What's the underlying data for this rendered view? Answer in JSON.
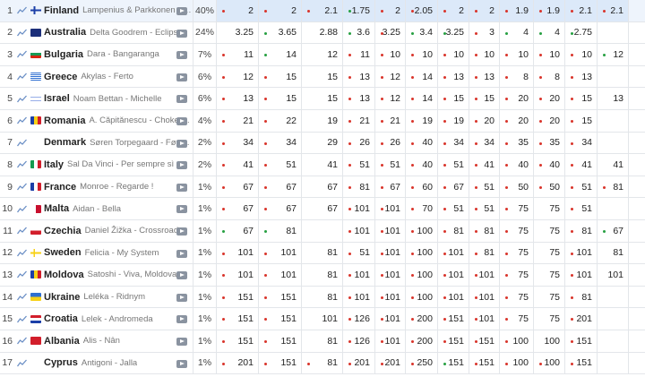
{
  "colors": {
    "red_dot": "#d9342b",
    "green_dot": "#26a041",
    "highlight": "#dce9f9",
    "trend_line": "#6b8fc5"
  },
  "icons": {
    "trend": "chart-line-icon",
    "video": "video-play-icon"
  },
  "rows": [
    {
      "rank": "1",
      "country": "Finland",
      "entry": "Lampenius & Parkkonen - Liekinheitin",
      "flag": "fi",
      "pct": "40%",
      "odds": [
        [
          "2",
          "r"
        ],
        [
          "2",
          "r"
        ],
        [
          "2.1",
          "r"
        ],
        [
          "1.75",
          "g"
        ],
        [
          "2",
          "r"
        ],
        [
          "2.05",
          "r"
        ],
        [
          "2",
          "r"
        ],
        [
          "2",
          "r"
        ],
        [
          "1.9",
          "r"
        ],
        [
          "1.9",
          "r"
        ],
        [
          "2.1",
          "r"
        ],
        [
          "2.1",
          "r"
        ]
      ]
    },
    {
      "rank": "2",
      "country": "Australia",
      "entry": "Delta Goodrem - Eclipse",
      "flag": "au",
      "pct": "24%",
      "odds": [
        [
          "3.25",
          ""
        ],
        [
          "3.65",
          "g"
        ],
        [
          "2.88",
          ""
        ],
        [
          "3.6",
          "g"
        ],
        [
          "3.25",
          "r"
        ],
        [
          "3.4",
          "g"
        ],
        [
          "3.25",
          "g"
        ],
        [
          "3",
          "r"
        ],
        [
          "4",
          "g"
        ],
        [
          "4",
          "g"
        ],
        [
          "2.75",
          "g"
        ],
        [
          "",
          ""
        ]
      ]
    },
    {
      "rank": "3",
      "country": "Bulgaria",
      "entry": "Dara - Bangaranga",
      "flag": "bg",
      "pct": "7%",
      "odds": [
        [
          "11",
          "r"
        ],
        [
          "14",
          "g"
        ],
        [
          "12",
          ""
        ],
        [
          "11",
          "r"
        ],
        [
          "10",
          "r"
        ],
        [
          "10",
          "r"
        ],
        [
          "10",
          "r"
        ],
        [
          "10",
          "r"
        ],
        [
          "10",
          "r"
        ],
        [
          "10",
          "r"
        ],
        [
          "10",
          "r"
        ],
        [
          "12",
          "g"
        ]
      ]
    },
    {
      "rank": "4",
      "country": "Greece",
      "entry": "Akylas - Ferto",
      "flag": "gr",
      "pct": "6%",
      "odds": [
        [
          "12",
          "r"
        ],
        [
          "15",
          "r"
        ],
        [
          "15",
          ""
        ],
        [
          "13",
          "r"
        ],
        [
          "12",
          "r"
        ],
        [
          "14",
          "r"
        ],
        [
          "13",
          "r"
        ],
        [
          "13",
          "r"
        ],
        [
          "8",
          "r"
        ],
        [
          "8",
          "r"
        ],
        [
          "13",
          "r"
        ],
        [
          "",
          ""
        ]
      ]
    },
    {
      "rank": "5",
      "country": "Israel",
      "entry": "Noam Bettan - Michelle",
      "flag": "il",
      "pct": "6%",
      "odds": [
        [
          "13",
          "r"
        ],
        [
          "15",
          "r"
        ],
        [
          "15",
          ""
        ],
        [
          "13",
          "r"
        ],
        [
          "12",
          "r"
        ],
        [
          "14",
          "r"
        ],
        [
          "15",
          "r"
        ],
        [
          "15",
          "r"
        ],
        [
          "20",
          "r"
        ],
        [
          "20",
          "r"
        ],
        [
          "15",
          "r"
        ],
        [
          "13",
          ""
        ]
      ]
    },
    {
      "rank": "6",
      "country": "Romania",
      "entry": "A. Căpitănescu - Choke Me",
      "flag": "ro",
      "pct": "4%",
      "odds": [
        [
          "21",
          "r"
        ],
        [
          "22",
          "r"
        ],
        [
          "19",
          ""
        ],
        [
          "21",
          "r"
        ],
        [
          "21",
          "r"
        ],
        [
          "19",
          "r"
        ],
        [
          "19",
          "r"
        ],
        [
          "20",
          "r"
        ],
        [
          "20",
          "r"
        ],
        [
          "20",
          "r"
        ],
        [
          "15",
          "r"
        ],
        [
          "",
          ""
        ]
      ]
    },
    {
      "rank": "7",
      "country": "Denmark",
      "entry": "Søren Torpegaard - Før vi går hjem",
      "flag": "dk",
      "pct": "2%",
      "odds": [
        [
          "34",
          "r"
        ],
        [
          "34",
          "r"
        ],
        [
          "29",
          ""
        ],
        [
          "26",
          "r"
        ],
        [
          "26",
          "r"
        ],
        [
          "40",
          "r"
        ],
        [
          "34",
          "r"
        ],
        [
          "34",
          "r"
        ],
        [
          "35",
          "r"
        ],
        [
          "35",
          "r"
        ],
        [
          "34",
          "r"
        ],
        [
          "",
          ""
        ]
      ]
    },
    {
      "rank": "8",
      "country": "Italy",
      "entry": "Sal Da Vinci - Per sempre sì",
      "flag": "it",
      "pct": "2%",
      "odds": [
        [
          "41",
          "r"
        ],
        [
          "51",
          "r"
        ],
        [
          "41",
          ""
        ],
        [
          "51",
          "r"
        ],
        [
          "51",
          "r"
        ],
        [
          "40",
          "r"
        ],
        [
          "51",
          "r"
        ],
        [
          "41",
          "r"
        ],
        [
          "40",
          "r"
        ],
        [
          "40",
          "r"
        ],
        [
          "41",
          "r"
        ],
        [
          "41",
          ""
        ]
      ]
    },
    {
      "rank": "9",
      "country": "France",
      "entry": "Monroe - Regarde !",
      "flag": "fr",
      "pct": "1%",
      "odds": [
        [
          "67",
          "r"
        ],
        [
          "67",
          "r"
        ],
        [
          "67",
          ""
        ],
        [
          "81",
          "r"
        ],
        [
          "67",
          "r"
        ],
        [
          "60",
          "r"
        ],
        [
          "67",
          "r"
        ],
        [
          "51",
          "r"
        ],
        [
          "50",
          "r"
        ],
        [
          "50",
          "r"
        ],
        [
          "51",
          "r"
        ],
        [
          "81",
          "r"
        ]
      ]
    },
    {
      "rank": "10",
      "country": "Malta",
      "entry": "Aidan - Bella",
      "flag": "mt",
      "pct": "1%",
      "odds": [
        [
          "67",
          "r"
        ],
        [
          "67",
          "r"
        ],
        [
          "67",
          ""
        ],
        [
          "101",
          "r"
        ],
        [
          "101",
          "r"
        ],
        [
          "70",
          "r"
        ],
        [
          "51",
          "r"
        ],
        [
          "51",
          "r"
        ],
        [
          "75",
          "r"
        ],
        [
          "75",
          ""
        ],
        [
          "51",
          "r"
        ],
        [
          "",
          ""
        ]
      ]
    },
    {
      "rank": "11",
      "country": "Czechia",
      "entry": "Daniel Žižka - Crossroads",
      "flag": "cz",
      "pct": "1%",
      "odds": [
        [
          "67",
          "g"
        ],
        [
          "81",
          "g"
        ],
        [
          "",
          ""
        ],
        [
          "101",
          "r"
        ],
        [
          "101",
          "r"
        ],
        [
          "100",
          "r"
        ],
        [
          "81",
          "r"
        ],
        [
          "81",
          "r"
        ],
        [
          "75",
          "r"
        ],
        [
          "75",
          ""
        ],
        [
          "81",
          "r"
        ],
        [
          "67",
          "g"
        ]
      ]
    },
    {
      "rank": "12",
      "country": "Sweden",
      "entry": "Felicia - My System",
      "flag": "se",
      "pct": "1%",
      "odds": [
        [
          "101",
          "r"
        ],
        [
          "101",
          "r"
        ],
        [
          "81",
          ""
        ],
        [
          "51",
          "r"
        ],
        [
          "101",
          "r"
        ],
        [
          "100",
          "r"
        ],
        [
          "101",
          "r"
        ],
        [
          "81",
          "r"
        ],
        [
          "75",
          "r"
        ],
        [
          "75",
          ""
        ],
        [
          "101",
          "r"
        ],
        [
          "81",
          ""
        ]
      ]
    },
    {
      "rank": "13",
      "country": "Moldova",
      "entry": "Satoshi - Viva, Moldova",
      "flag": "md",
      "pct": "1%",
      "odds": [
        [
          "101",
          "r"
        ],
        [
          "101",
          "r"
        ],
        [
          "81",
          ""
        ],
        [
          "101",
          "r"
        ],
        [
          "101",
          "r"
        ],
        [
          "100",
          "r"
        ],
        [
          "101",
          "r"
        ],
        [
          "101",
          "r"
        ],
        [
          "75",
          "r"
        ],
        [
          "75",
          ""
        ],
        [
          "101",
          "r"
        ],
        [
          "101",
          ""
        ]
      ]
    },
    {
      "rank": "14",
      "country": "Ukraine",
      "entry": "Leléka - Ridnym",
      "flag": "ua",
      "pct": "1%",
      "odds": [
        [
          "151",
          "r"
        ],
        [
          "151",
          "r"
        ],
        [
          "81",
          ""
        ],
        [
          "101",
          "r"
        ],
        [
          "101",
          "r"
        ],
        [
          "100",
          "r"
        ],
        [
          "101",
          "r"
        ],
        [
          "101",
          "r"
        ],
        [
          "75",
          "r"
        ],
        [
          "75",
          ""
        ],
        [
          "81",
          "r"
        ],
        [
          "",
          ""
        ]
      ]
    },
    {
      "rank": "15",
      "country": "Croatia",
      "entry": "Lelek - Andromeda",
      "flag": "hr",
      "pct": "1%",
      "odds": [
        [
          "151",
          "r"
        ],
        [
          "151",
          "r"
        ],
        [
          "101",
          ""
        ],
        [
          "126",
          "r"
        ],
        [
          "101",
          "r"
        ],
        [
          "200",
          "r"
        ],
        [
          "151",
          "r"
        ],
        [
          "101",
          "r"
        ],
        [
          "75",
          "r"
        ],
        [
          "75",
          ""
        ],
        [
          "201",
          "r"
        ],
        [
          "",
          ""
        ]
      ]
    },
    {
      "rank": "16",
      "country": "Albania",
      "entry": "Alis - Nân",
      "flag": "al",
      "pct": "1%",
      "odds": [
        [
          "151",
          "r"
        ],
        [
          "151",
          "r"
        ],
        [
          "81",
          ""
        ],
        [
          "126",
          "r"
        ],
        [
          "101",
          "r"
        ],
        [
          "200",
          "r"
        ],
        [
          "151",
          "r"
        ],
        [
          "151",
          "r"
        ],
        [
          "100",
          "r"
        ],
        [
          "100",
          ""
        ],
        [
          "151",
          "r"
        ],
        [
          "",
          ""
        ]
      ]
    },
    {
      "rank": "17",
      "country": "Cyprus",
      "entry": "Antigoni - Jalla",
      "flag": "cy",
      "pct": "1%",
      "odds": [
        [
          "201",
          "r"
        ],
        [
          "151",
          "r"
        ],
        [
          "81",
          "r"
        ],
        [
          "201",
          "r"
        ],
        [
          "201",
          "r"
        ],
        [
          "250",
          "r"
        ],
        [
          "151",
          "g"
        ],
        [
          "151",
          "r"
        ],
        [
          "100",
          "r"
        ],
        [
          "100",
          "r"
        ],
        [
          "151",
          "r"
        ],
        [
          "",
          ""
        ]
      ]
    }
  ]
}
